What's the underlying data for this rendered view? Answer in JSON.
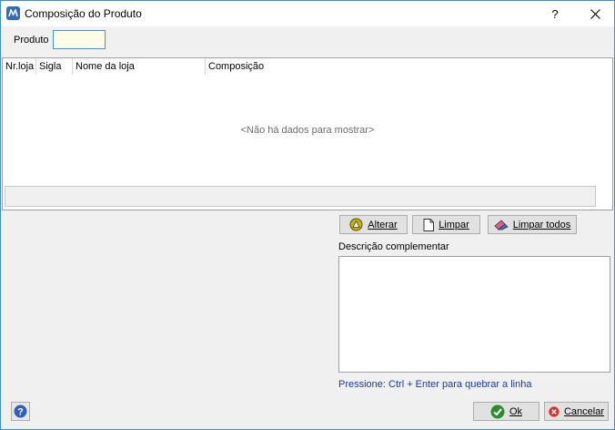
{
  "window": {
    "title": "Composição do Produto",
    "help_glyph": "?",
    "close_glyph": "✕"
  },
  "produto": {
    "label": "Produto",
    "value": ""
  },
  "grid": {
    "columns": [
      "Nr.loja",
      "Sigla",
      "Nome da loja",
      "Composição"
    ],
    "rows": [],
    "empty_text": "<Não há dados para mostrar>"
  },
  "actions": {
    "alterar": {
      "label": "Alterar",
      "icon": "triangle-up-icon"
    },
    "limpar": {
      "label": "Limpar",
      "icon": "blank-page-icon"
    },
    "limpar_todos": {
      "label": "Limpar todos",
      "icon": "eraser-icon"
    }
  },
  "descricao": {
    "label": "Descrição complementar",
    "value": "",
    "hint": "Pressione: Ctrl + Enter para quebrar a linha"
  },
  "footer": {
    "ok": {
      "label": "Ok",
      "icon": "check-icon"
    },
    "cancelar": {
      "label": "Cancelar",
      "icon": "cancel-icon"
    },
    "help_icon": "help-icon"
  },
  "colors": {
    "window_border": "#3a8fd6",
    "input_background": "#fffde6",
    "hint_text": "#1c3a9a",
    "ok_icon": "#2e8b2e",
    "cancel_icon": "#d93030"
  }
}
